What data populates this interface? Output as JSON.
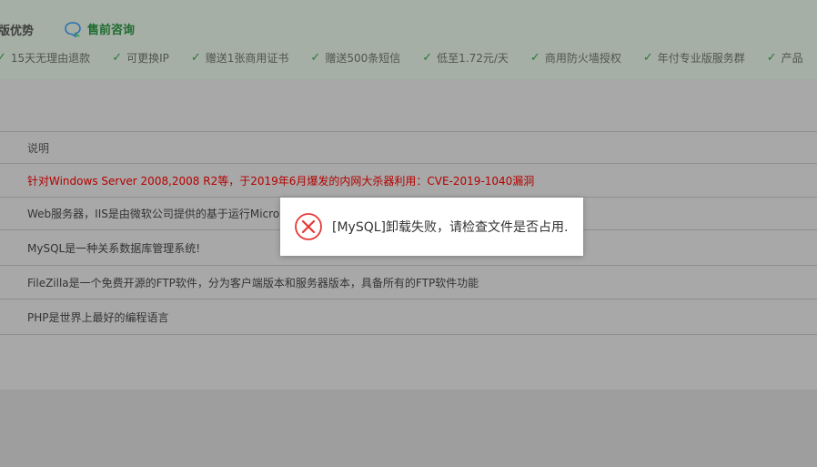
{
  "top": {
    "section_title": "版优势",
    "consult_label": "售前咨询",
    "features": [
      "15天无理由退款",
      "可更换IP",
      "赠送1张商用证书",
      "赠送500条短信",
      "低至1.72元/天",
      "商用防火墙授权",
      "年付专业版服务群",
      "产品"
    ]
  },
  "table": {
    "header": "说明",
    "rows": [
      "针对Windows Server 2008,2008 R2等，于2019年6月爆发的内网大杀器利用：CVE-2019-1040漏洞",
      "Web服务器，IIS是由微软公司提供的基于运行Micro",
      "MySQL是一种关系数据库管理系统!",
      "FileZilla是一个免费开源的FTP软件，分为客户端版本和服务器版本，具备所有的FTP软件功能",
      "PHP是世界上最好的编程语言"
    ]
  },
  "toast": {
    "message": "[MySQL]卸载失败，请检查文件是否占用."
  },
  "colors": {
    "alert_text": "#b50000",
    "toast_icon": "#e53935",
    "consult_green": "#1e6b2f"
  }
}
